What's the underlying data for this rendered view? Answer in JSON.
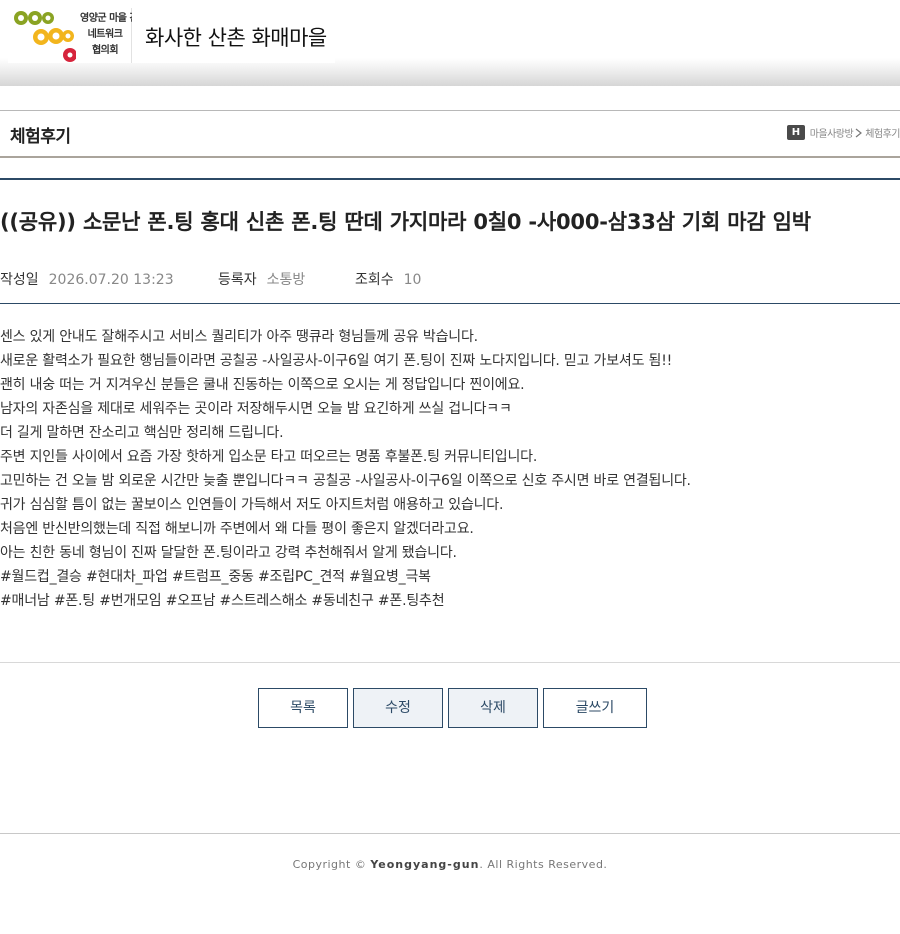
{
  "header": {
    "logo_lines": [
      "영양군 마을 간",
      "네트워크",
      "협의회"
    ],
    "site_title": "화사한 산촌 화매마을"
  },
  "page": {
    "title": "체험후기",
    "breadcrumb_home": "H",
    "breadcrumb": [
      "마을사랑방",
      "체험후기"
    ]
  },
  "post": {
    "title": "((공유)) 소문난 폰.팅 홍대 신촌 폰.팅 딴데 가지마라 0칠0 -사000-삼33삼 기회 마감 임박",
    "meta": {
      "date_label": "작성일",
      "date_value": "2026.07.20 13:23",
      "author_label": "등록자",
      "author_value": "소통방",
      "views_label": "조회수",
      "views_value": "10"
    },
    "body_lines": [
      "센스 있게 안내도 잘해주시고 서비스 퀄리티가 아주 땡큐라 형님들께 공유 박습니다.",
      "새로운 활력소가 필요한 행님들이라면 공칠공 -사일공사-이구6일 여기 폰.팅이 진짜 노다지입니다. 믿고 가보셔도 됨!!",
      "괜히 내숭 떠는 거 지겨우신 분들은 쿨내 진동하는 이쪽으로 오시는 게 정답입니다 찐이에요.",
      "남자의 자존심을 제대로 세워주는 곳이라 저장해두시면 오늘 밤 요긴하게 쓰실 겁니다ㅋㅋ",
      "더 길게 말하면 잔소리고 핵심만 정리해 드립니다.",
      "주변 지인들 사이에서 요즘 가장 핫하게 입소문 타고 떠오르는 명품 후불폰.팅 커뮤니티입니다.",
      "고민하는 건 오늘 밤 외로운 시간만 늦출 뿐입니다ㅋㅋ 공칠공 -사일공사-이구6일 이쪽으로 신호 주시면 바로 연결됩니다.",
      "귀가 심심할 틈이 없는 꿀보이스 인연들이 가득해서 저도 아지트처럼 애용하고 있습니다.",
      "처음엔 반신반의했는데 직접 해보니까 주변에서 왜 다들 평이 좋은지 알겠더라고요.",
      "아는 친한 동네 형님이 진짜 달달한 폰.팅이라고 강력 추천해줘서 알게 됐습니다.",
      "#월드컵_결승 #현대차_파업 #트럼프_중동 #조립PC_견적 #월요병_극복",
      "#매너남 #폰.팅 #번개모임 #오프남 #스트레스해소 #동네친구 #폰.팅추천"
    ]
  },
  "buttons": {
    "list": "목록",
    "edit": "수정",
    "delete": "삭제",
    "write": "글쓰기"
  },
  "footer": {
    "prefix": "Copyright © ",
    "brand": "Yeongyang-gun",
    "suffix": ". All Rights Reserved."
  },
  "colors": {
    "accent": "#2c4a66",
    "logo_green": "#8aa323",
    "logo_yellow": "#f2b51d",
    "logo_red": "#d6243c"
  }
}
